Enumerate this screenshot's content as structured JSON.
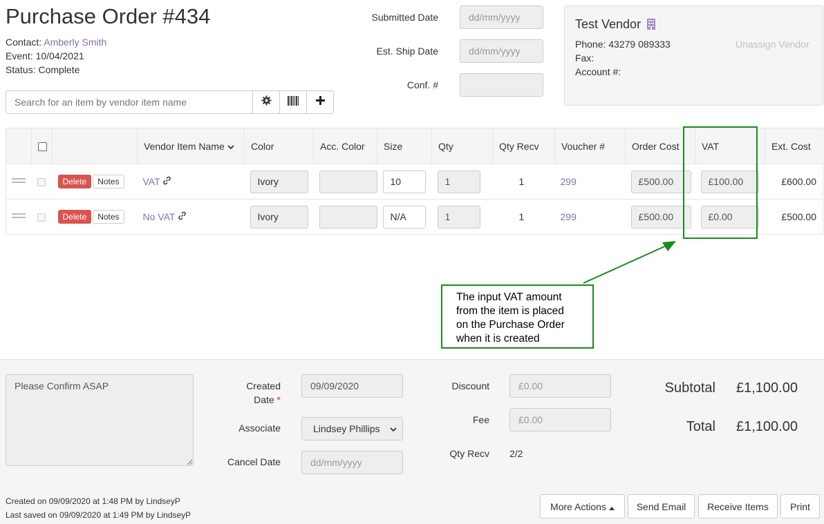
{
  "header": {
    "title": "Purchase Order #434",
    "contact_label": "Contact: ",
    "contact_name": "Amberly Smith",
    "event": "Event: 10/04/2021",
    "status": "Status: Complete"
  },
  "dates": {
    "submitted_label": "Submitted Date",
    "submitted_placeholder": "dd/mm/yyyy",
    "ship_label": "Est. Ship Date",
    "ship_placeholder": "dd/mm/yyyy",
    "conf_label": "Conf. #",
    "conf_value": ""
  },
  "vendor": {
    "name": "Test Vendor",
    "phone": "Phone: 43279 089333",
    "fax": "Fax:",
    "account": "Account #:",
    "unassign": "Unassign Vendor"
  },
  "search": {
    "placeholder": "Search for an item by vendor item name"
  },
  "table": {
    "headers": [
      "Vendor Item Name",
      "Color",
      "Acc. Color",
      "Size",
      "Qty",
      "Qty Recv",
      "Voucher #",
      "Order Cost",
      "VAT",
      "Ext. Cost"
    ],
    "delete_label": "Delete",
    "notes_label": "Notes",
    "rows": [
      {
        "name": "VAT",
        "color": "Ivory",
        "acc_color": "",
        "size": "10",
        "qty": "1",
        "qty_recv": "1",
        "voucher": "299",
        "order_cost": "£500.00",
        "vat": "£100.00",
        "ext_cost": "£600.00"
      },
      {
        "name": "No VAT",
        "color": "Ivory",
        "acc_color": "",
        "size": "N/A",
        "qty": "1",
        "qty_recv": "1",
        "voucher": "299",
        "order_cost": "£500.00",
        "vat": "£0.00",
        "ext_cost": "£500.00"
      }
    ]
  },
  "annotation": {
    "text": "The input VAT amount from the item is placed on the Purchase Order when it is created",
    "color": "#1a8a1a"
  },
  "footer": {
    "notes": "Please Confirm ASAP",
    "created_label": "Created",
    "created_label2": "Date",
    "required_mark": "*",
    "created_date": "09/09/2020",
    "associate_label": "Associate",
    "associate_value": "Lindsey Phillips",
    "cancel_label": "Cancel Date",
    "cancel_placeholder": "dd/mm/yyyy",
    "discount_label": "Discount",
    "discount_value": "£0.00",
    "fee_label": "Fee",
    "fee_value": "£0.00",
    "qty_recv_label": "Qty Recv",
    "qty_recv_value": "2/2",
    "subtotal_label": "Subtotal",
    "subtotal_value": "£1,100.00",
    "total_label": "Total",
    "total_value": "£1,100.00",
    "created_on": "Created on 09/09/2020 at 1:48 PM by LindseyP",
    "last_saved": "Last saved on 09/09/2020 at 1:49 PM by LindseyP"
  },
  "actions": {
    "more": "More Actions",
    "send_email": "Send Email",
    "receive": "Receive Items",
    "print": "Print"
  },
  "colors": {
    "accent_link": "#8a6fa8",
    "danger": "#d9534f"
  }
}
